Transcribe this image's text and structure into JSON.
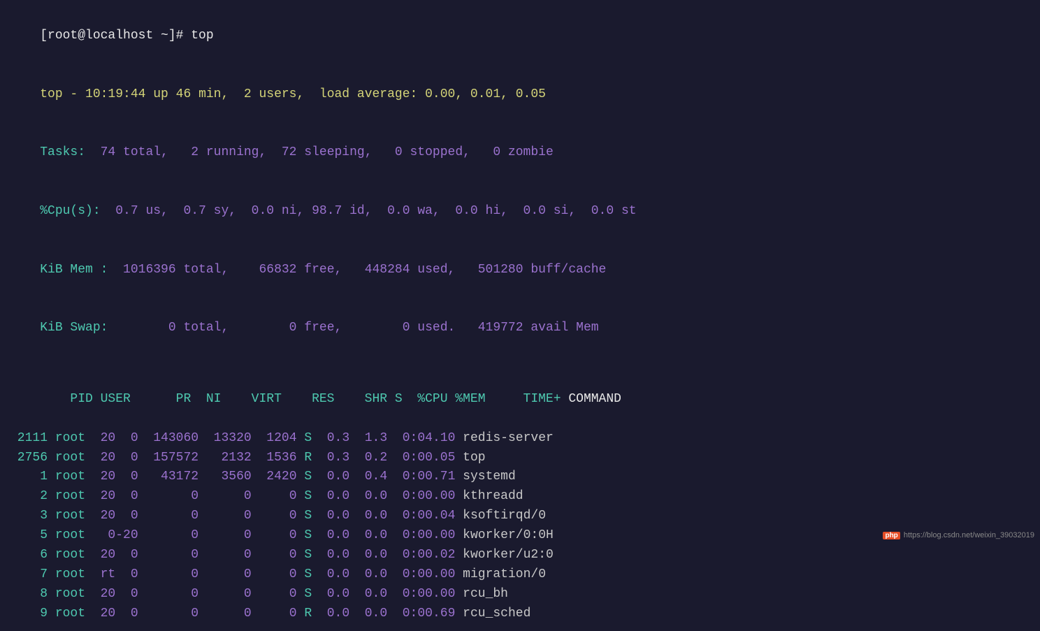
{
  "terminal": {
    "prompt_line": "[root@localhost ~]# top",
    "header": {
      "line1_prefix": "top - ",
      "line1_time": "10:19:44",
      "line1_rest": " up 46 min,  2 users,  load average: 0.00, 0.01, 0.05",
      "line2_label": "Tasks:",
      "line2_value": "  74 total,   2 running,  72 sleeping,   0 stopped,   0 zombie",
      "line3_label": "%Cpu(s):",
      "line3_value": "  0.7 us,  0.7 sy,  0.0 ni, 98.7 id,  0.0 wa,  0.0 hi,  0.0 si,  0.0 st",
      "line4_label": "KiB Mem :",
      "line4_value": "  1016396 total,    66832 free,   448284 used,   501280 buff/cache",
      "line5_label": "KiB Swap:",
      "line5_value": "        0 total,        0 free,        0 used.   419772 avail Mem"
    },
    "table": {
      "columns": "  PID USER      PR  NI    VIRT    RES    SHR S  %CPU %MEM     TIME+ COMMAND",
      "rows": [
        {
          "pid": " 2111",
          "user": " root",
          "pr": "  20",
          "ni": "  0",
          "virt": "  143060",
          "res": "  13320",
          "shr": "  1204",
          "s": "S",
          "cpu": "  0.3",
          "mem": "  1.3",
          "time": "  0:04.10",
          "cmd": " redis-server"
        },
        {
          "pid": " 2756",
          "user": " root",
          "pr": "  20",
          "ni": "  0",
          "virt": "  157572",
          "res": "   2132",
          "shr": "  1536",
          "s": "R",
          "cpu": "  0.3",
          "mem": "  0.2",
          "time": "  0:00.05",
          "cmd": " top"
        },
        {
          "pid": "    1",
          "user": " root",
          "pr": "  20",
          "ni": "  0",
          "virt": "   43172",
          "res": "   3560",
          "shr": "  2420",
          "s": "S",
          "cpu": "  0.0",
          "mem": "  0.4",
          "time": "  0:00.71",
          "cmd": " systemd"
        },
        {
          "pid": "    2",
          "user": " root",
          "pr": "  20",
          "ni": "  0",
          "virt": "       0",
          "res": "      0",
          "shr": "     0",
          "s": "S",
          "cpu": "  0.0",
          "mem": "  0.0",
          "time": "  0:00.00",
          "cmd": " kthreadd"
        },
        {
          "pid": "    3",
          "user": " root",
          "pr": "  20",
          "ni": "  0",
          "virt": "       0",
          "res": "      0",
          "shr": "     0",
          "s": "S",
          "cpu": "  0.0",
          "mem": "  0.0",
          "time": "  0:00.04",
          "cmd": " ksoftirqd/0"
        },
        {
          "pid": "    5",
          "user": " root",
          "pr": "   0",
          "ni": "-20",
          "virt": "       0",
          "res": "      0",
          "shr": "     0",
          "s": "S",
          "cpu": "  0.0",
          "mem": "  0.0",
          "time": "  0:00.00",
          "cmd": " kworker/0:0H"
        },
        {
          "pid": "    6",
          "user": " root",
          "pr": "  20",
          "ni": "  0",
          "virt": "       0",
          "res": "      0",
          "shr": "     0",
          "s": "S",
          "cpu": "  0.0",
          "mem": "  0.0",
          "time": "  0:00.02",
          "cmd": " kworker/u2:0"
        },
        {
          "pid": "    7",
          "user": " root",
          "pr": "  rt",
          "ni": "  0",
          "virt": "       0",
          "res": "      0",
          "shr": "     0",
          "s": "S",
          "cpu": "  0.0",
          "mem": "  0.0",
          "time": "  0:00.00",
          "cmd": " migration/0"
        },
        {
          "pid": "    8",
          "user": " root",
          "pr": "  20",
          "ni": "  0",
          "virt": "       0",
          "res": "      0",
          "shr": "     0",
          "s": "S",
          "cpu": "  0.0",
          "mem": "  0.0",
          "time": "  0:00.00",
          "cmd": " rcu_bh"
        },
        {
          "pid": "    9",
          "user": " root",
          "pr": "  20",
          "ni": "  0",
          "virt": "       0",
          "res": "      0",
          "shr": "     0",
          "s": "R",
          "cpu": "  0.0",
          "mem": "  0.0",
          "time": "  0:00.69",
          "cmd": " rcu_sched"
        }
      ]
    },
    "watermark": {
      "php": "php",
      "url": "https://blog.csdn.net/weixin_39032019"
    }
  }
}
